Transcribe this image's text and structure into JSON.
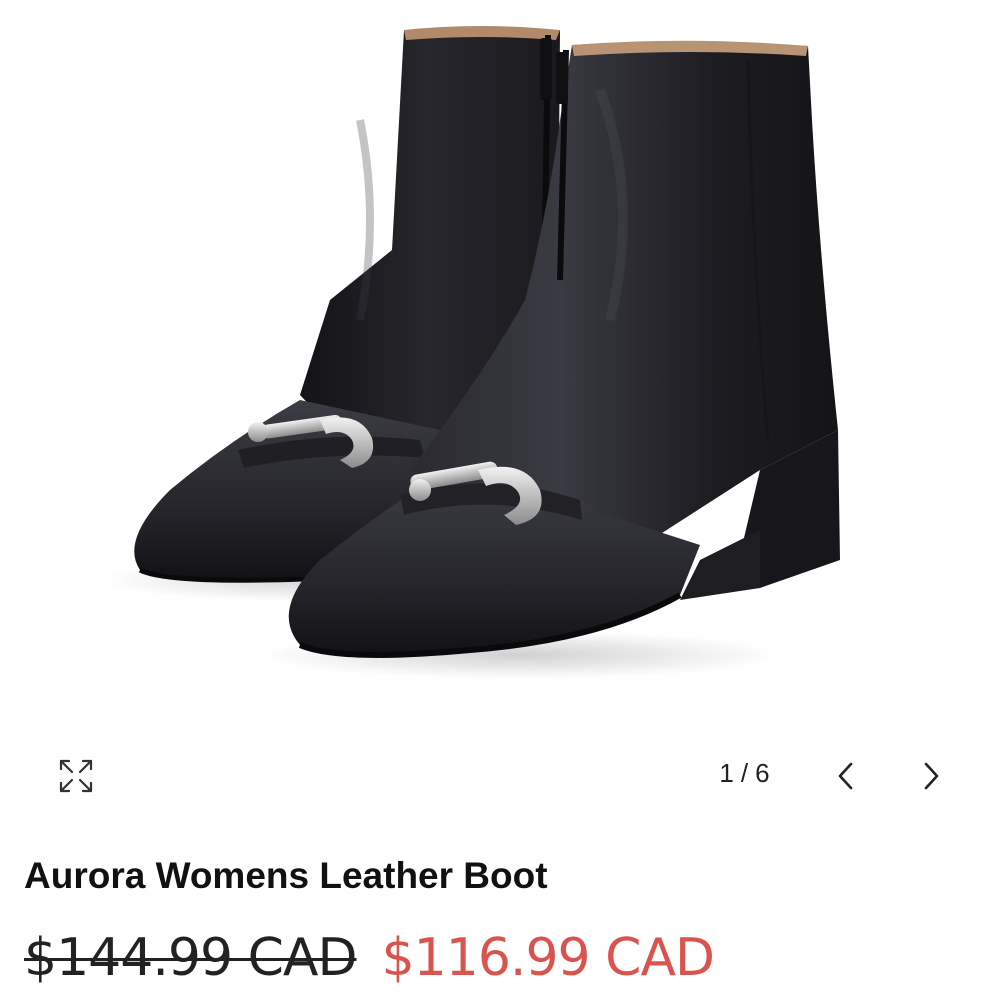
{
  "product": {
    "title": "Aurora Womens Leather Boot",
    "price_original": "$144.99 CAD",
    "price_sale": "$116.99 CAD",
    "image_alt": "Black leather ankle boots with silver horsebit hardware"
  },
  "gallery": {
    "current": "1",
    "separator": "/",
    "total": "6",
    "expand_icon": "expand-arrows-icon",
    "prev_icon": "chevron-left-icon",
    "next_icon": "chevron-right-icon"
  },
  "colors": {
    "sale_price": "#d9534f",
    "text": "#111111",
    "boot": "#1c1c20",
    "hardware": "#c9c9c9"
  }
}
